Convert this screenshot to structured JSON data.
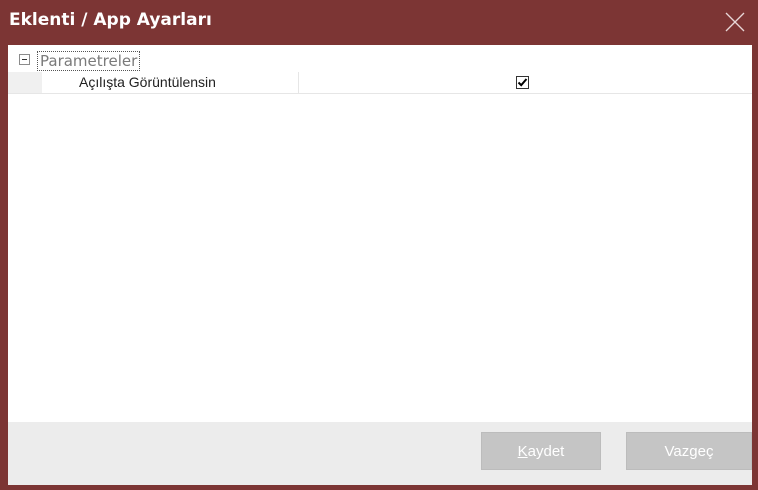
{
  "window": {
    "title": "Eklenti / App Ayarları"
  },
  "property_grid": {
    "group": {
      "label": "Parametreler",
      "expanded": true
    },
    "properties": [
      {
        "name": "Açılışta Görüntülensin",
        "checked": true
      }
    ]
  },
  "footer": {
    "save_mnemonic": "K",
    "save_rest": "aydet",
    "cancel_label": "Vazgeç"
  },
  "colors": {
    "window_frame": "#7c3534",
    "button_disabled": "#c5c5c5",
    "footer_bg": "#ececec"
  },
  "icons": {
    "close": "close-icon",
    "collapse": "collapse-icon",
    "check": "checkmark-icon"
  }
}
